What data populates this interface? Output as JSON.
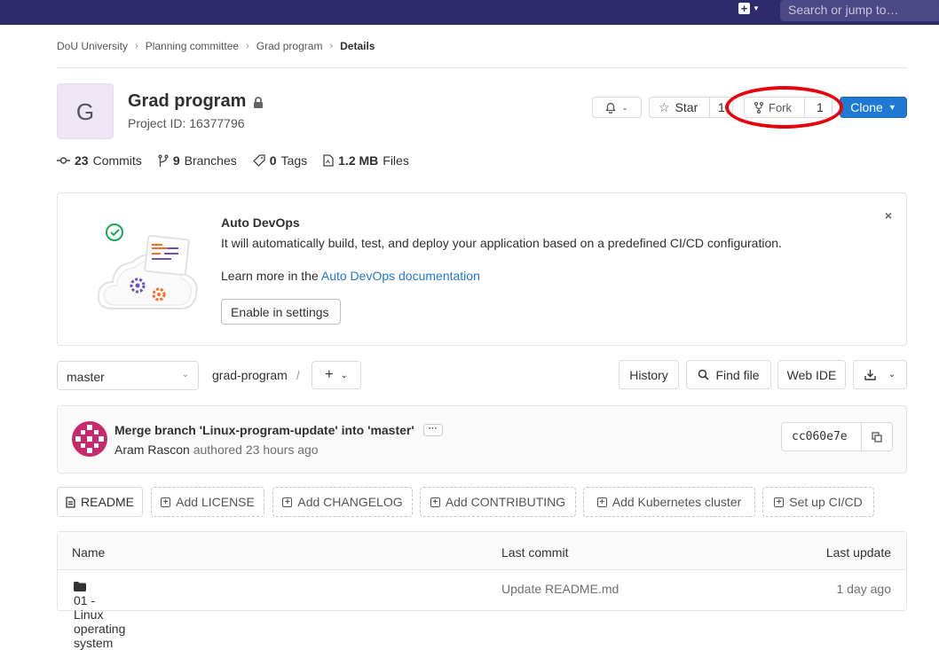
{
  "topbar": {
    "search_placeholder": "Search or jump to…"
  },
  "breadcrumb": {
    "items": [
      "DoU University",
      "Planning committee",
      "Grad program"
    ],
    "current": "Details"
  },
  "project": {
    "avatar_letter": "G",
    "name": "Grad program",
    "id_label": "Project ID: 16377796"
  },
  "actions": {
    "star_label": "Star",
    "star_count": "1",
    "fork_label": "Fork",
    "fork_count": "1",
    "clone_label": "Clone"
  },
  "stats": [
    {
      "value": "23",
      "label": "Commits"
    },
    {
      "value": "9",
      "label": "Branches"
    },
    {
      "value": "0",
      "label": "Tags"
    },
    {
      "value": "1.2 MB",
      "label": "Files"
    }
  ],
  "devops": {
    "title": "Auto DevOps",
    "description": "It will automatically build, test, and deploy your application based on a predefined CI/CD configuration.",
    "learn_prefix": "Learn more in the ",
    "learn_link": "Auto DevOps documentation",
    "enable_label": "Enable in settings",
    "close": "×"
  },
  "repo_nav": {
    "branch": "master",
    "path": "grad-program",
    "separator": "/",
    "history_label": "History",
    "find_file_label": "Find file",
    "web_ide_label": "Web IDE"
  },
  "last_commit": {
    "message": "Merge branch 'Linux-program-update' into 'master'",
    "more": "···",
    "author": "Aram Rascon",
    "authored": " authored 23 hours ago",
    "sha": "cc060e7e"
  },
  "quick_actions": {
    "readme": "README",
    "license": "Add LICENSE",
    "changelog": "Add CHANGELOG",
    "contributing": "Add CONTRIBUTING",
    "kubernetes": "Add Kubernetes cluster",
    "cicd": "Set up CI/CD"
  },
  "files_table": {
    "headers": {
      "name": "Name",
      "last_commit": "Last commit",
      "last_update": "Last update"
    },
    "rows": [
      {
        "name": "01 - Linux operating system",
        "last_commit": "Update README.md",
        "last_update": "1 day ago"
      }
    ]
  },
  "colors": {
    "topbar": "#2f2a6b",
    "accent": "#1f78d1",
    "highlight_ring": "#e8000b"
  }
}
